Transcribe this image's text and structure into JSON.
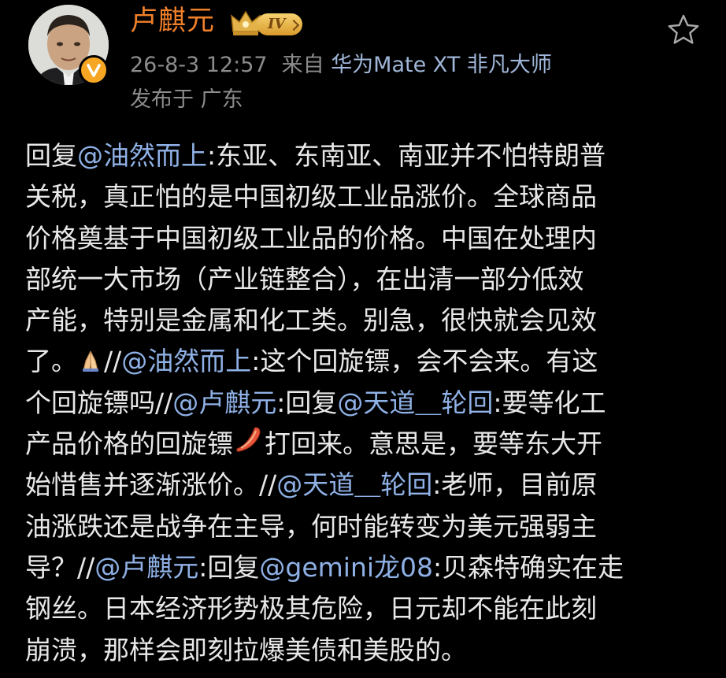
{
  "header": {
    "username": "卢麒元",
    "level": "IV",
    "timestamp": "26-8-3 12:57",
    "source_prefix": "来自",
    "device": "华为Mate XT 非凡大师",
    "location": "发布于 广东",
    "icons": {
      "avatar": "user-avatar",
      "verified": "verified-v-icon",
      "crown": "crown-icon",
      "favorite": "star-icon"
    }
  },
  "colors": {
    "background": "#000000",
    "username": "#f0802a",
    "meta": "#8c8c8c",
    "mention": "#8fb1e6",
    "body_text": "#e8e8e8",
    "verified_badge": "#f6a623"
  },
  "post": {
    "lines": [
      [
        {
          "t": "回复"
        },
        {
          "t": "@油然而上",
          "m": true
        },
        {
          "t": ":东亚、东南亚、南亚并不怕特朗普"
        }
      ],
      [
        {
          "t": "关税，真正怕的是中国初级工业品涨价。全球商品"
        }
      ],
      [
        {
          "t": "价格奠基于中国初级工业品的价格。中国在处理内"
        }
      ],
      [
        {
          "t": "部统一大市场（产业链整合），在出清一部分低效"
        }
      ],
      [
        {
          "t": "产能，特别是金属和化工类。别急，很快就会见效"
        }
      ],
      [
        {
          "t": "了。"
        },
        {
          "e": "folded-hands-emoji"
        },
        {
          "t": "//"
        },
        {
          "t": "@油然而上",
          "m": true
        },
        {
          "t": ":这个回旋镖，会不会来。有这"
        }
      ],
      [
        {
          "t": "个回旋镖吗//"
        },
        {
          "t": "@卢麒元",
          "m": true
        },
        {
          "t": ":回复"
        },
        {
          "t": "@天道＿轮回",
          "m": true
        },
        {
          "t": ":要等化工"
        }
      ],
      [
        {
          "t": "产品价格的回旋镖"
        },
        {
          "e": "boomerang-emoji"
        },
        {
          "t": "打回来。意思是，要等东大开"
        }
      ],
      [
        {
          "t": "始惜售并逐渐涨价。//"
        },
        {
          "t": "@天道＿轮回",
          "m": true
        },
        {
          "t": ":老师，目前原"
        }
      ],
      [
        {
          "t": "油涨跌还是战争在主导，何时能转变为美元强弱主"
        }
      ],
      [
        {
          "t": "导？//"
        },
        {
          "t": "@卢麒元",
          "m": true
        },
        {
          "t": ":回复"
        },
        {
          "t": "@gemini龙08",
          "m": true
        },
        {
          "t": ":贝森特确实在走"
        }
      ],
      [
        {
          "t": "钢丝。日本经济形势极其危险，日元却不能在此刻"
        }
      ],
      [
        {
          "t": "崩溃，那样会即刻拉爆美债和美股的。"
        }
      ]
    ]
  }
}
